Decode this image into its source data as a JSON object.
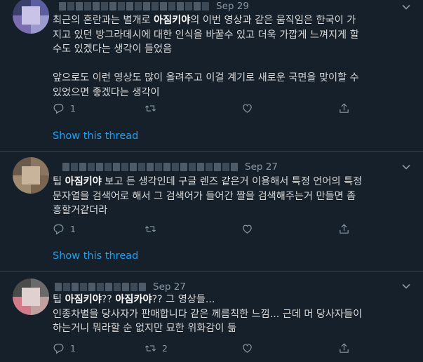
{
  "tweets": [
    {
      "date": "Sep 29",
      "body_lines": [
        [
          {
            "t": "최근의 혼란과는 별개로 "
          },
          {
            "t": "아짐키야",
            "b": true
          },
          {
            "t": "의 이번 영상과 같은 움직임은 한국이 가"
          }
        ],
        [
          {
            "t": "지고 있던 방그라데시에 대한 인식을 바꿀수 있고 더욱 가깝게 느껴지게 할"
          }
        ],
        [
          {
            "t": "수도 있겠다는 생각이 들었음"
          }
        ],
        [
          {
            "t": ""
          }
        ],
        [
          {
            "t": "앞으로도 이런 영상도 많이 올려주고 이걸 계기로 새로운 국면을 맞이할 수"
          }
        ],
        [
          {
            "t": "있었으면 좋겠다는 생각이"
          }
        ]
      ],
      "reply_count": "1",
      "retweet_count": "",
      "like_count": "",
      "show_thread": "Show this thread"
    },
    {
      "date": "Sep 27",
      "body_lines": [
        [
          {
            "t": "팁 "
          },
          {
            "t": "아짐키야",
            "b": true
          },
          {
            "t": " 보고 든 생각인데 구글 렌즈 같은거 이용해서 특정 언어의 특정"
          }
        ],
        [
          {
            "t": "문자열을 검색어로 해서 그 검색어가 들어간 짤을 검색해주는거 만들면 좀"
          }
        ],
        [
          {
            "t": "흥할거같더라"
          }
        ]
      ],
      "reply_count": "1",
      "retweet_count": "",
      "like_count": "",
      "show_thread": "Show this thread"
    },
    {
      "date": "Sep 27",
      "body_lines": [
        [
          {
            "t": "팁 "
          },
          {
            "t": "아짐키야",
            "b": true
          },
          {
            "t": "?? "
          },
          {
            "t": "아짐카야",
            "b": true
          },
          {
            "t": "?? 그 영상들..."
          }
        ],
        [
          {
            "t": "인종차별을 당사자가 판매합니다 같은 께름칙한 느낌... 근데 머 당사자들이"
          }
        ],
        [
          {
            "t": "하는거니 뭐라할 순 없지만 묘한 위화감이 듦"
          }
        ]
      ],
      "reply_count": "1",
      "retweet_count": "2",
      "like_count": ""
    }
  ],
  "icons": {
    "reply": "reply-icon",
    "retweet": "retweet-icon",
    "like": "heart-icon",
    "share": "share-icon",
    "more": "chevron-down-icon"
  },
  "colors": {
    "background": "#15202b",
    "separator": "#38444d",
    "link": "#1da1f2",
    "muted": "#8899a6",
    "text": "#d9d9d9"
  }
}
